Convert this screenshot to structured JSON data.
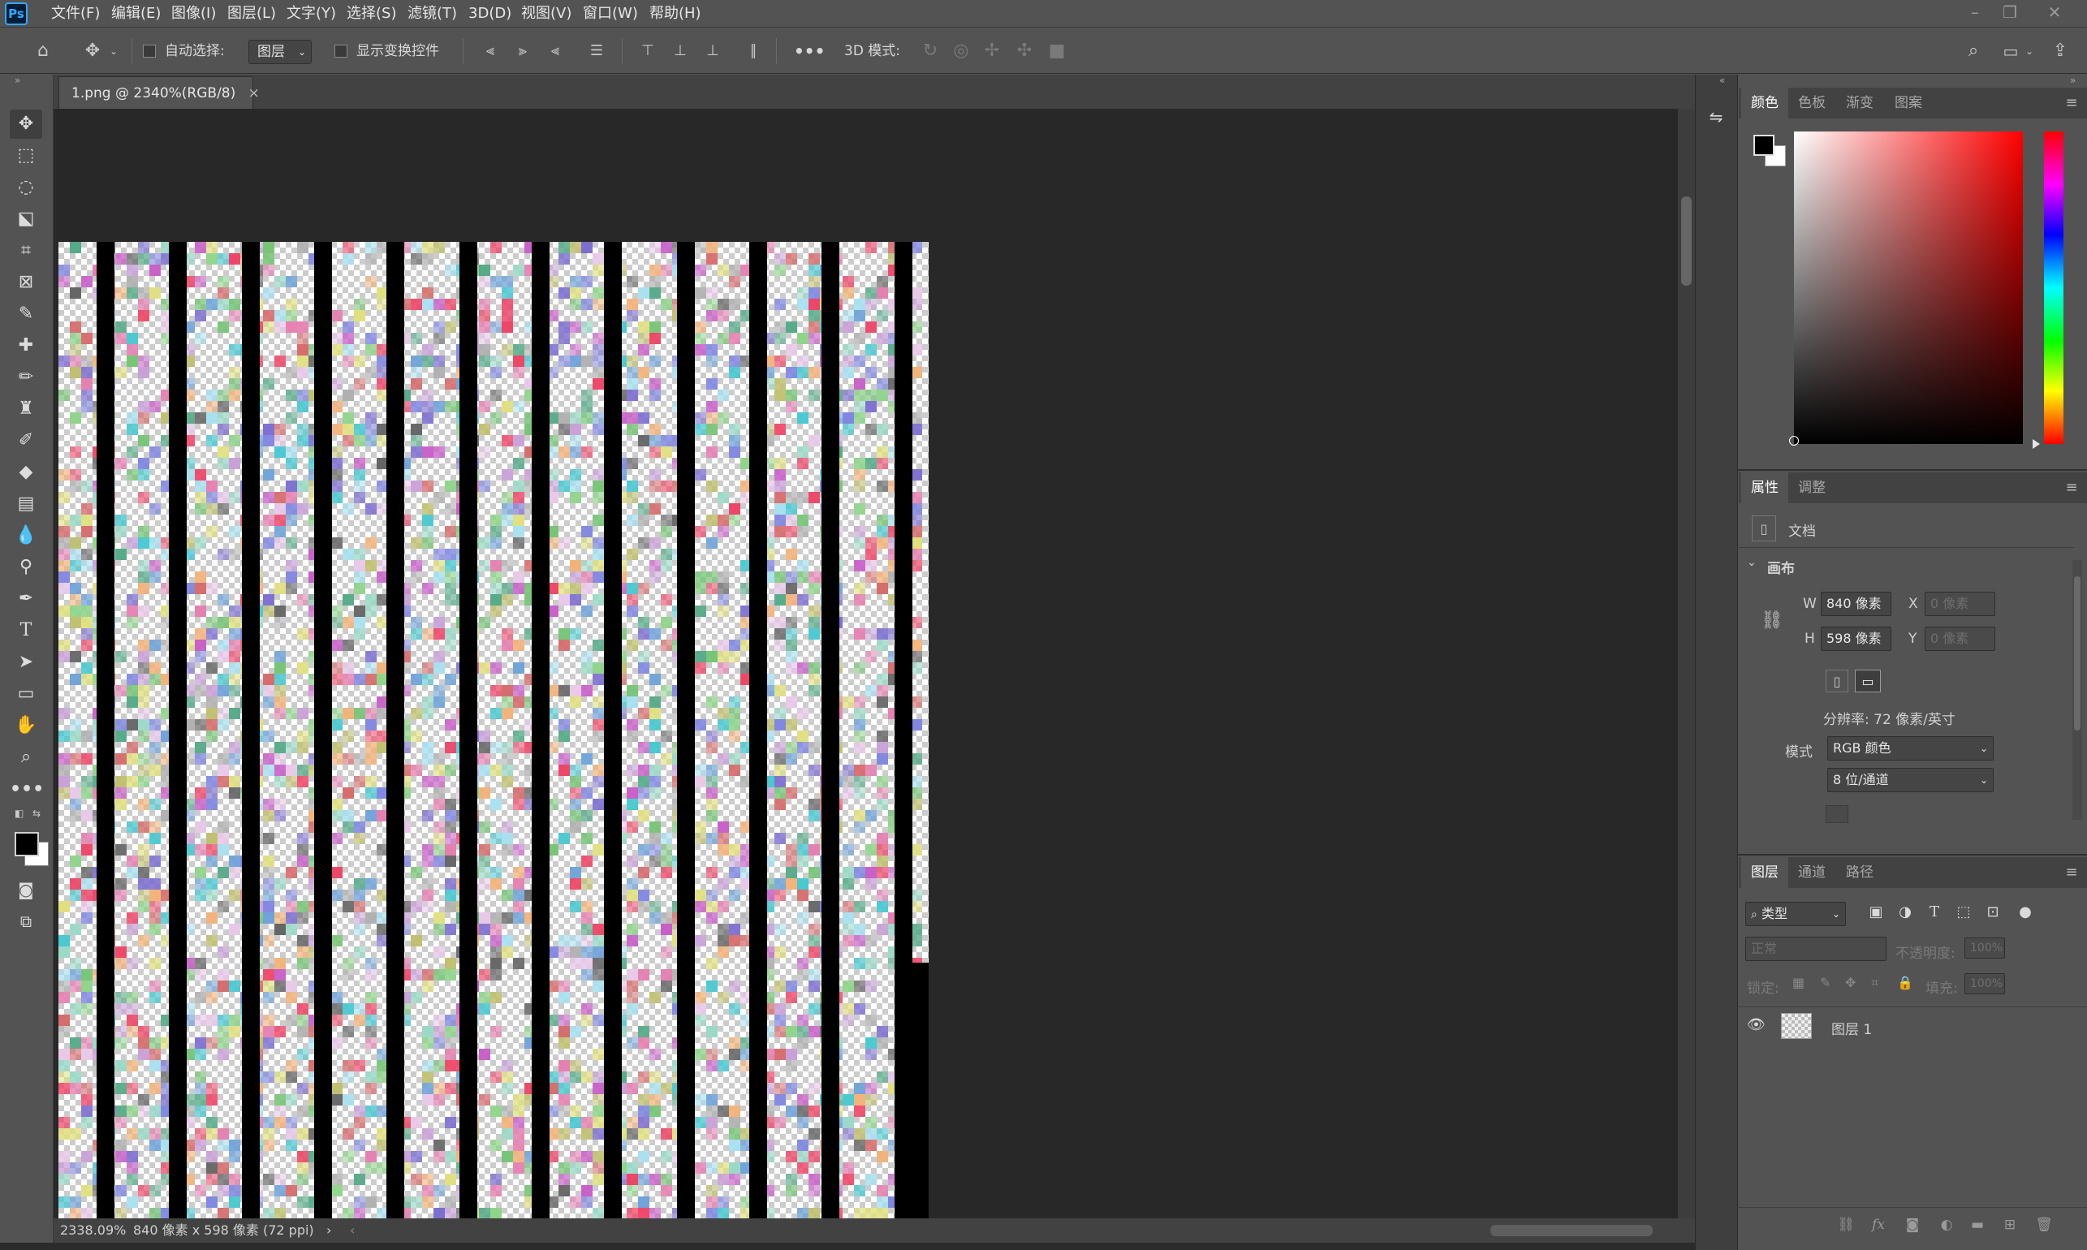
{
  "app": {
    "logo": "Ps"
  },
  "menu": [
    "文件(F)",
    "编辑(E)",
    "图像(I)",
    "图层(L)",
    "文字(Y)",
    "选择(S)",
    "滤镜(T)",
    "3D(D)",
    "视图(V)",
    "窗口(W)",
    "帮助(H)"
  ],
  "window_controls": {
    "minimize": "–",
    "restore": "❐",
    "close": "✕"
  },
  "options": {
    "auto_select_label": "自动选择:",
    "auto_select_value": "图层",
    "show_transform_label": "显示变换控件",
    "more": "•••",
    "mode_3d_label": "3D 模式:"
  },
  "document": {
    "tab_title": "1.png @ 2340%(RGB/8)",
    "tab_close": "×"
  },
  "status": {
    "zoom": "2338.09%",
    "info": "840 像素 x 598 像素 (72 ppi)",
    "arrow": "›",
    "arrow_left": "‹"
  },
  "canvas": {
    "bars": 12,
    "bar_color": "#000000",
    "background": "#282828"
  },
  "color_panel": {
    "tabs": [
      "颜色",
      "色板",
      "渐变",
      "图案"
    ],
    "foreground": "#000000",
    "background": "#ffffff",
    "hue_color": "#ff0000"
  },
  "properties_panel": {
    "tabs": [
      "属性",
      "调整"
    ],
    "doc_label": "文档",
    "canvas_section": "画布",
    "w_label": "W",
    "w_value": "840 像素",
    "h_label": "H",
    "h_value": "598 像素",
    "x_label": "X",
    "x_value": "0 像素",
    "y_label": "Y",
    "y_value": "0 像素",
    "resolution": "分辨率: 72 像素/英寸",
    "mode_label": "模式",
    "mode_value": "RGB 颜色",
    "depth_value": "8 位/通道"
  },
  "layers_panel": {
    "tabs": [
      "图层",
      "通道",
      "路径"
    ],
    "filter_kind": "类型",
    "blend_mode": "正常",
    "opacity_label": "不透明度:",
    "opacity_value": "100%",
    "lock_label": "锁定:",
    "fill_label": "填充:",
    "fill_value": "100%",
    "layers": [
      {
        "name": "图层 1",
        "visible": true
      }
    ]
  }
}
